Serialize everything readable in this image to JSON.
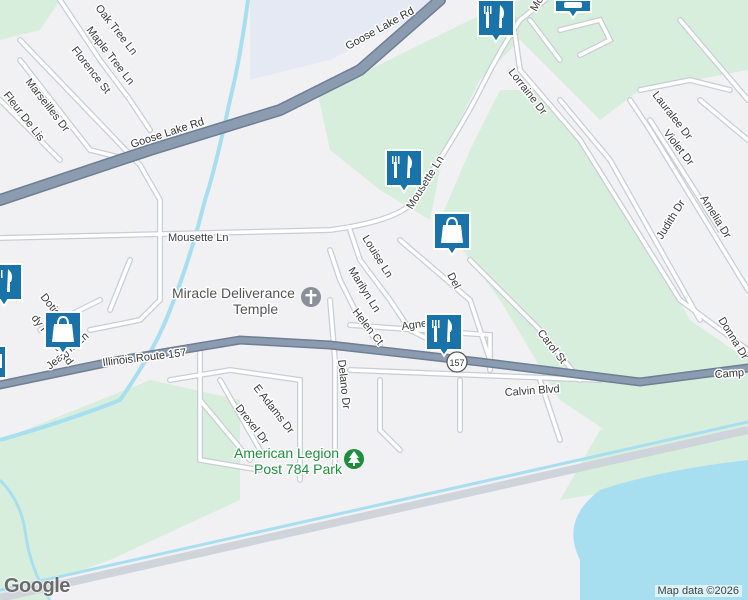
{
  "colors": {
    "land": "#f1f1f3",
    "water": "#a7dff0",
    "park": "#d8eedc",
    "highway": "#8b9bb0",
    "road": "#ffffff",
    "road_edge": "#c9cdd4",
    "marker": "#1a73a8",
    "park_green": "#1e8e3e"
  },
  "streets": {
    "oak_tree": "Oak Tree Ln",
    "maple_tree": "Maple Tree Ln",
    "florence": "Florence St",
    "marseilles": "Marseilles Dr",
    "fleur_de_lis": "Fleur De Lis",
    "goose_lake_1": "Goose Lake Rd",
    "goose_lake_2": "Goose Lake Rd",
    "mousette_1": "Mousette Ln",
    "mousette_2": "Mousette Ln",
    "mousette_3": "Mo",
    "lorraine": "Lorraine Dr",
    "lauralee": "Lauralee Dr",
    "violet": "Violet Dr",
    "judith": "Judith Dr",
    "amelia": "Amelia Dr",
    "donna": "Donna Dr",
    "louise": "Louise Ln",
    "marilyn": "Marilyn Ln",
    "helen": "Helen Ct",
    "agnes": "Agnes",
    "del": "Del",
    "carol": "Carol St",
    "calvin": "Calvin Blvd",
    "delano": "Delano Dr",
    "e_adams": "E Adams Dr",
    "drexel": "Drexel Dr",
    "jeanne": "Jeanne Ln",
    "dotie": "Dotie",
    "ridge": "dy Ridge Rd",
    "illinois_157": "Illinois Route 157",
    "camp": "Camp",
    "route_shield": "157"
  },
  "places": {
    "church_line1": "Miracle Deliverance",
    "church_line2": "Temple",
    "park_line1": "American Legion",
    "park_line2": "Post 784 Park"
  },
  "markers": [
    {
      "type": "restaurant",
      "icon": "fork-knife-icon"
    },
    {
      "type": "restaurant",
      "icon": "fork-knife-icon"
    },
    {
      "type": "restaurant",
      "icon": "fork-knife-icon"
    },
    {
      "type": "restaurant",
      "icon": "fork-knife-icon"
    },
    {
      "type": "shopping",
      "icon": "shopping-bag-icon"
    },
    {
      "type": "shopping",
      "icon": "shopping-bag-icon"
    },
    {
      "type": "store",
      "icon": "store-icon"
    },
    {
      "type": "store",
      "icon": "store-icon"
    }
  ],
  "attribution": "Map data ©2026",
  "logo": "Google"
}
